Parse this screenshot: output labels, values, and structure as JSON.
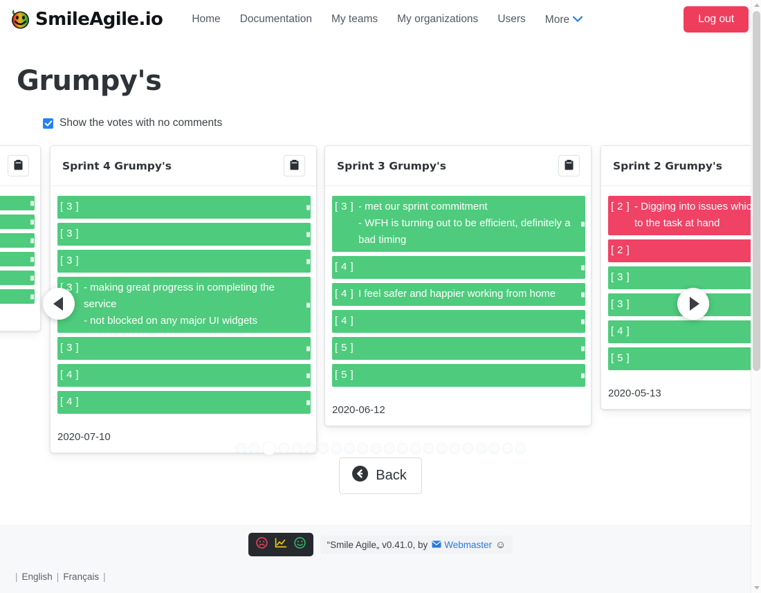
{
  "nav": {
    "brand": "SmileAgile.io",
    "brand_logo_icon": "smiley-sprout-logo-icon",
    "links": [
      {
        "label": "Home",
        "name": "home"
      },
      {
        "label": "Documentation",
        "name": "documentation"
      },
      {
        "label": "My teams",
        "name": "my-teams"
      },
      {
        "label": "My organizations",
        "name": "my-organizations"
      },
      {
        "label": "Users",
        "name": "users"
      },
      {
        "label": "More",
        "name": "more",
        "caret": "⌄"
      }
    ],
    "logout_label": "Log out",
    "logout_color": "#ef3e5c"
  },
  "page": {
    "title": "Grumpy's",
    "checkbox_label": "Show the votes with no comments",
    "checkbox_checked": true,
    "checkbox_color": "#2382f5"
  },
  "colors": {
    "vote_green": "#4ecb7d",
    "vote_red": "#ef4265"
  },
  "carousel": {
    "prev_label": "◀",
    "next_label": "▶",
    "dot_count": 22,
    "active_dot_index": 2,
    "cards": [
      {
        "id": "partial-left",
        "title": "",
        "date": "",
        "delete_icon": "clipboard-icon",
        "votes": [
          {
            "score": "",
            "comment": "",
            "color": "green"
          },
          {
            "score": "",
            "comment": "",
            "color": "green"
          },
          {
            "score": "",
            "comment": "",
            "color": "green"
          },
          {
            "score": "",
            "comment": "",
            "color": "green"
          },
          {
            "score": "",
            "comment": "",
            "color": "green"
          },
          {
            "score": "",
            "comment": "",
            "color": "green"
          }
        ]
      },
      {
        "id": "sprint-4",
        "title": "Sprint 4 Grumpy's",
        "date": "2020-07-10",
        "delete_icon": "clipboard-icon",
        "votes": [
          {
            "score": "[ 3 ]",
            "comment": "",
            "color": "green"
          },
          {
            "score": "[ 3 ]",
            "comment": "",
            "color": "green"
          },
          {
            "score": "[ 3 ]",
            "comment": "",
            "color": "green"
          },
          {
            "score": "[ 3 ]",
            "comment": "- making great progress in completing the service\n- not blocked on any major UI widgets",
            "color": "green"
          },
          {
            "score": "[ 3 ]",
            "comment": "",
            "color": "green"
          },
          {
            "score": "[ 4 ]",
            "comment": "",
            "color": "green"
          },
          {
            "score": "[ 4 ]",
            "comment": "",
            "color": "green"
          }
        ]
      },
      {
        "id": "sprint-3",
        "title": "Sprint 3 Grumpy's",
        "date": "2020-06-12",
        "delete_icon": "clipboard-icon",
        "votes": [
          {
            "score": "[ 3 ]",
            "comment": "- met our sprint commitment\n- WFH is turning out to be efficient, definitely a bad timing",
            "color": "green"
          },
          {
            "score": "[ 4 ]",
            "comment": "",
            "color": "green"
          },
          {
            "score": "[ 4 ]",
            "comment": "I feel safer and happier working from home",
            "color": "green"
          },
          {
            "score": "[ 4 ]",
            "comment": "",
            "color": "green"
          },
          {
            "score": "[ 5 ]",
            "comment": "",
            "color": "green"
          },
          {
            "score": "[ 5 ]",
            "comment": "",
            "color": "green"
          }
        ]
      },
      {
        "id": "sprint-2",
        "title": "Sprint 2 Grumpy's",
        "date": "2020-05-13",
        "delete_icon": "clipboard-icon",
        "votes": [
          {
            "score": "[ 2 ]",
            "comment": "- Digging into issues which ar\nto the task at hand",
            "color": "red"
          },
          {
            "score": "[ 2 ]",
            "comment": "",
            "color": "red"
          },
          {
            "score": "[ 3 ]",
            "comment": "",
            "color": "green"
          },
          {
            "score": "[ 3 ]",
            "comment": "",
            "color": "green"
          },
          {
            "score": "[ 4 ]",
            "comment": "",
            "color": "green"
          },
          {
            "score": "[ 5 ]",
            "comment": "",
            "color": "green"
          }
        ]
      }
    ]
  },
  "back": {
    "label": "Back",
    "icon": "arrow-circle-left-icon"
  },
  "footer": {
    "mood_icons": [
      {
        "name": "sad-face-icon",
        "color": "#ef3e5c"
      },
      {
        "name": "chart-line-icon",
        "color": "#f0c419"
      },
      {
        "name": "happy-face-icon",
        "color": "#2fb86a"
      }
    ],
    "credit_prefix": "“Smile Agile„ v0.41.0, by",
    "credit_mail_icon": "envelope-icon",
    "credit_link": "Webmaster",
    "credit_suffix": "☺",
    "languages": [
      {
        "label": "English",
        "name": "english"
      },
      {
        "label": "Français",
        "name": "francais"
      }
    ],
    "separator": "|"
  }
}
